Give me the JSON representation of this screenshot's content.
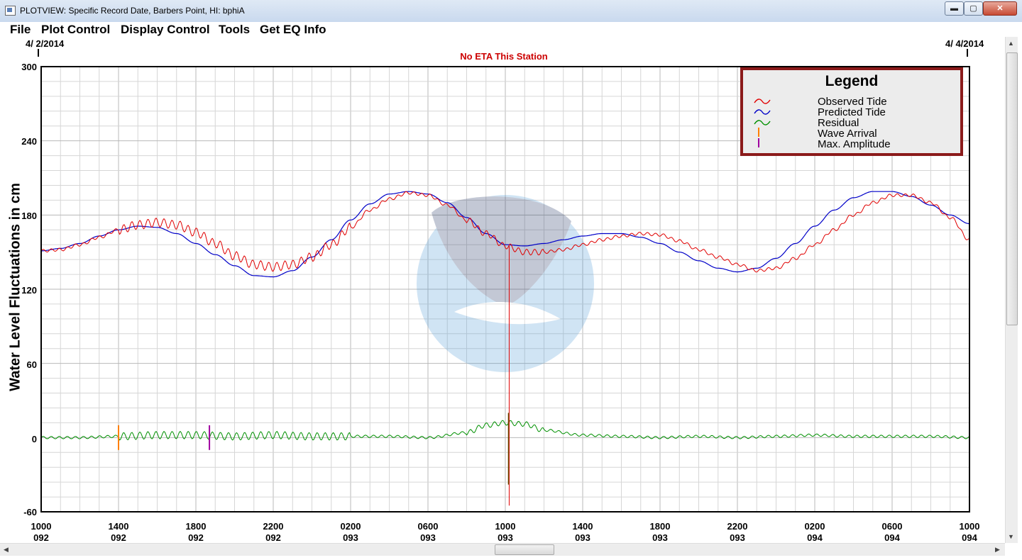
{
  "window": {
    "title": "PLOTVIEW: Specific Record Date, Barbers Point, HI: bphiA",
    "buttons": {
      "minimize": "▬",
      "maximize": "▢",
      "close": "✕"
    }
  },
  "menu": [
    "File",
    "Plot Control",
    "Display Control",
    "Tools",
    "Get EQ Info"
  ],
  "header": {
    "start_date": "4/ 2/2014",
    "end_date": "4/ 4/2014",
    "eta_notice": "No ETA This Station"
  },
  "legend": {
    "title": "Legend",
    "items": [
      "Observed Tide",
      "Predicted Tide",
      "Residual",
      "Wave Arrival",
      "Max. Amplitude"
    ]
  },
  "colors": {
    "observed": "#e00000",
    "predicted": "#0000c8",
    "residual": "#009000",
    "wave_arrival": "#ff8000",
    "max_amplitude": "#a000a0",
    "grid": "#c8c8c8",
    "legend_border": "#8b1a1a",
    "eta_text": "#cc0000"
  },
  "icons": {
    "app": "window-icon",
    "watermark": "noaa-logo-watermark",
    "scroll_up": "arrow-up-icon",
    "scroll_down": "arrow-down-icon",
    "scroll_left": "arrow-left-icon",
    "scroll_right": "arrow-right-icon"
  },
  "chart_data": {
    "type": "line",
    "ylabel": "Water Level Fluctuations in cm",
    "ylim": [
      -60,
      300
    ],
    "yticks": [
      "300",
      "240",
      "180",
      "120",
      "60",
      "0",
      "-60"
    ],
    "xlim_hours": [
      0,
      48
    ],
    "xticks": [
      {
        "time": "1000",
        "day": "092"
      },
      {
        "time": "1400",
        "day": "092"
      },
      {
        "time": "1800",
        "day": "092"
      },
      {
        "time": "2200",
        "day": "092"
      },
      {
        "time": "0200",
        "day": "093"
      },
      {
        "time": "0600",
        "day": "093"
      },
      {
        "time": "1000",
        "day": "093"
      },
      {
        "time": "1400",
        "day": "093"
      },
      {
        "time": "1800",
        "day": "093"
      },
      {
        "time": "2200",
        "day": "093"
      },
      {
        "time": "0200",
        "day": "094"
      },
      {
        "time": "0600",
        "day": "094"
      },
      {
        "time": "1000",
        "day": "094"
      }
    ],
    "grid": true,
    "legend_position": "top-right",
    "series": [
      {
        "name": "Observed Tide",
        "hours": [
          0,
          1,
          2,
          3,
          4,
          5,
          6,
          7,
          8,
          9,
          10,
          11,
          12,
          13,
          14,
          15,
          16,
          17,
          18,
          19,
          20,
          21,
          22,
          23,
          24,
          25,
          26,
          27,
          28,
          29,
          30,
          31,
          32,
          33,
          34,
          35,
          36,
          37,
          38,
          39,
          40,
          41,
          42,
          43,
          44,
          45,
          46,
          47,
          48
        ],
        "values": [
          151,
          152,
          156,
          162,
          168,
          172,
          174,
          172,
          166,
          157,
          147,
          140,
          138,
          140,
          146,
          156,
          170,
          184,
          193,
          198,
          196,
          188,
          176,
          165,
          155,
          150,
          150,
          152,
          156,
          160,
          163,
          165,
          164,
          159,
          152,
          146,
          140,
          135,
          137,
          145,
          156,
          168,
          180,
          190,
          196,
          196,
          190,
          178,
          160
        ]
      },
      {
        "name": "Predicted Tide",
        "hours": [
          0,
          1,
          2,
          3,
          4,
          5,
          6,
          7,
          8,
          9,
          10,
          11,
          12,
          13,
          14,
          15,
          16,
          17,
          18,
          19,
          20,
          21,
          22,
          23,
          24,
          25,
          26,
          27,
          28,
          29,
          30,
          31,
          32,
          33,
          34,
          35,
          36,
          37,
          38,
          39,
          40,
          41,
          42,
          43,
          44,
          45,
          46,
          47,
          48
        ],
        "values": [
          151,
          153,
          157,
          163,
          168,
          171,
          170,
          165,
          157,
          148,
          139,
          131,
          130,
          135,
          146,
          160,
          176,
          189,
          197,
          199,
          197,
          190,
          178,
          165,
          156,
          155,
          157,
          160,
          163,
          165,
          165,
          162,
          157,
          150,
          143,
          137,
          134,
          137,
          145,
          157,
          171,
          184,
          194,
          199,
          199,
          195,
          188,
          180,
          173
        ]
      },
      {
        "name": "Residual",
        "hours": [
          0,
          2,
          4,
          6,
          8,
          10,
          12,
          14,
          16,
          18,
          20,
          22,
          23,
          24,
          25,
          26,
          28,
          30,
          32,
          34,
          36,
          38,
          40,
          42,
          44,
          46,
          48
        ],
        "values": [
          0,
          0,
          1,
          2,
          2,
          1,
          2,
          1,
          1,
          1,
          0,
          4,
          10,
          12,
          11,
          6,
          2,
          1,
          0,
          1,
          0,
          1,
          2,
          1,
          1,
          1,
          0
        ]
      }
    ],
    "markers": [
      {
        "name": "Wave Arrival",
        "hour": 4.0,
        "low": -10,
        "high": 10
      },
      {
        "name": "Max. Amplitude",
        "hour": 8.7,
        "low": -10,
        "high": 10
      }
    ],
    "spike": {
      "hour": 24.2,
      "low": -55,
      "high": 155
    }
  }
}
